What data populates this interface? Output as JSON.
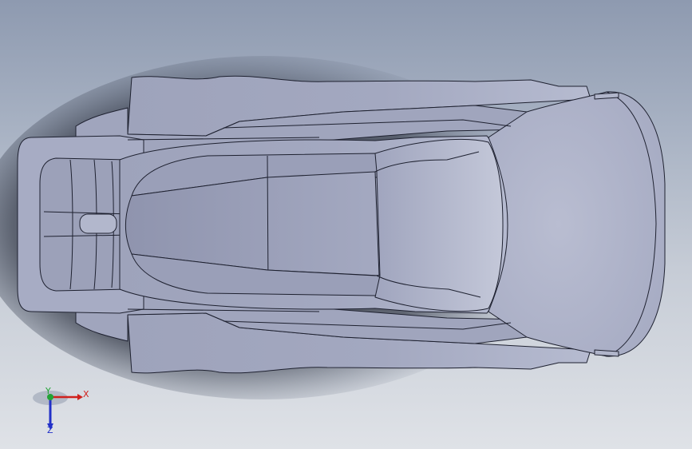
{
  "viewport": {
    "view": "top",
    "background_colors": [
      "#8e9ab0",
      "#dfe2e7"
    ],
    "model_color": "#a3a8c0",
    "edge_color": "#1e2130"
  },
  "triad": {
    "x_label": "X",
    "y_label": "Y",
    "z_label": "Z",
    "x_color": "#d0211d",
    "y_color": "#22a336",
    "z_color": "#2230c8"
  }
}
